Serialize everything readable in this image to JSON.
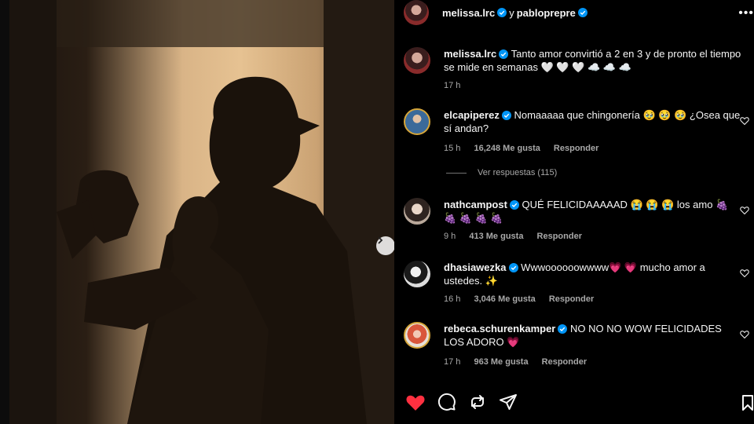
{
  "post": {
    "author": "melissa.lrc",
    "connector": "y",
    "coauthor": "pabloprepre",
    "caption": "Tanto amor convirtió a 2 en 3 y de pronto el tiempo se mide en semanas 🤍 🤍 🤍 ☁️ ☁️ ☁️",
    "time": "17 h"
  },
  "comments": [
    {
      "user": "elcapiperez",
      "text": "Nomaaaaa que chingonería 🥹 🥹 🥹 ¿Osea que sí andan?",
      "time": "15 h",
      "likes": "16,248 Me gusta",
      "reply": "Responder"
    },
    {
      "user": "nathcampost",
      "text": "QUÉ FELICIDAAAAAD 😭 😭 😭 los amo 🍇 🍇 🍇 🍇 🍇",
      "time": "9 h",
      "likes": "413 Me gusta",
      "reply": "Responder"
    },
    {
      "user": "dhasiawezka",
      "text": "Wwwoooooowwww💗 💗 mucho amor a ustedes. ✨",
      "time": "16 h",
      "likes": "3,046 Me gusta",
      "reply": "Responder"
    },
    {
      "user": "rebeca.schurenkamper",
      "text": "NO NO NO WOW FELICIDADES LOS ADORO 💗",
      "time": "17 h",
      "likes": "963 Me gusta",
      "reply": "Responder"
    }
  ],
  "view_replies": "Ver respuestas (115)",
  "colors": {
    "like_red": "#ff3040",
    "verified_blue": "#0095f6",
    "muted": "#a8a8a8"
  },
  "icons": [
    "heart-icon",
    "comment-icon",
    "share-icon",
    "send-icon",
    "bookmark-icon",
    "chevron-right-icon",
    "more-options-icon"
  ]
}
